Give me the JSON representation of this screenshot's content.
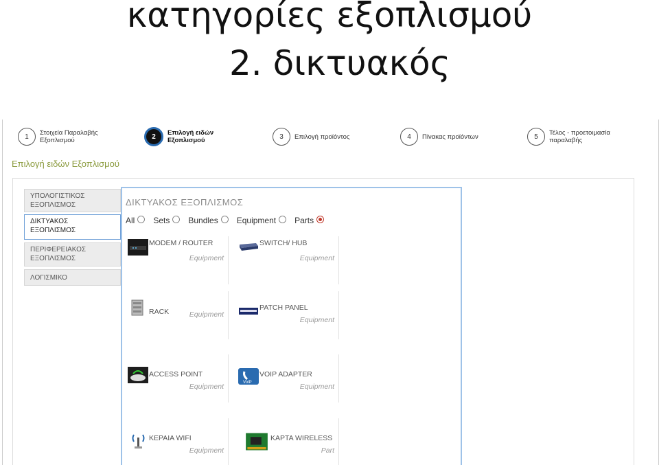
{
  "slide": {
    "title_line1": "κατηγορίες εξοπλισμού",
    "title_line2": "2. δικτυακός"
  },
  "wizard": {
    "steps": [
      {
        "number": "1",
        "label": "Στοιχεία Παραλαβής\nΕξοπλισμού"
      },
      {
        "number": "2",
        "label": "Επιλογή ειδών\nΕξοπλισμού"
      },
      {
        "number": "3",
        "label": "Επιλογή προϊόντος"
      },
      {
        "number": "4",
        "label": "Πίνακας προϊόντων"
      },
      {
        "number": "5",
        "label": "Τέλος - προετοιμασία\nπαραλαβής"
      }
    ],
    "active_step": "2"
  },
  "section_title": "Επιλογή ειδών Εξοπλισμού",
  "sidebar": {
    "tabs": [
      {
        "label": "ΥΠΟΛΟΓΙΣΤΙΚΟΣ\nΕΞΟΠΛΙΣΜΟΣ"
      },
      {
        "label": "ΔΙΚΤΥΑΚΟΣ\nΕΞΟΠΛΙΣΜΟΣ"
      },
      {
        "label": "ΠΕΡΙΦΕΡΕΙΑΚΟΣ\nΕΞΟΠΛΙΣΜΟΣ"
      },
      {
        "label": "ΛΟΓΙΣΜΙΚΟ"
      }
    ],
    "active_tab": "ΔΙΚΤΥΑΚΟΣ ΕΞΟΠΛΙΣΜΟΣ"
  },
  "content": {
    "title": "ΔΙΚΤΥΑΚΟΣ ΕΞΟΠΛΙΣΜΟΣ",
    "filters": [
      {
        "label": "All",
        "selected": false
      },
      {
        "label": "Sets",
        "selected": false
      },
      {
        "label": "Bundles",
        "selected": false
      },
      {
        "label": "Equipment",
        "selected": false
      },
      {
        "label": "Parts",
        "selected": true
      }
    ],
    "items": [
      {
        "name": "MODEM / ROUTER",
        "type": "Equipment",
        "icon": "router-icon"
      },
      {
        "name": "SWITCH/ HUB",
        "type": "Equipment",
        "icon": "switch-icon"
      },
      {
        "name": "RACK",
        "type": "Equipment",
        "icon": "rack-icon"
      },
      {
        "name": "PATCH PANEL",
        "type": "Equipment",
        "icon": "patch-panel-icon"
      },
      {
        "name": "ACCESS POINT",
        "type": "Equipment",
        "icon": "access-point-icon"
      },
      {
        "name": "VOIP ADAPTER",
        "type": "Equipment",
        "icon": "voip-adapter-icon"
      },
      {
        "name": "ΚΕΡΑΙΑ WIFI",
        "type": "Equipment",
        "icon": "wifi-antenna-icon"
      },
      {
        "name": "ΚΑΡΤΑ WIRELESS",
        "type": "Part",
        "icon": "wireless-card-icon"
      }
    ],
    "voip_icon_text": "VoIP"
  },
  "colors": {
    "section_title": "#8a9a3c",
    "content_border": "#9ec2e8",
    "active_step_ring": "#2a6bb0",
    "radio_selected": "#c0392b"
  }
}
